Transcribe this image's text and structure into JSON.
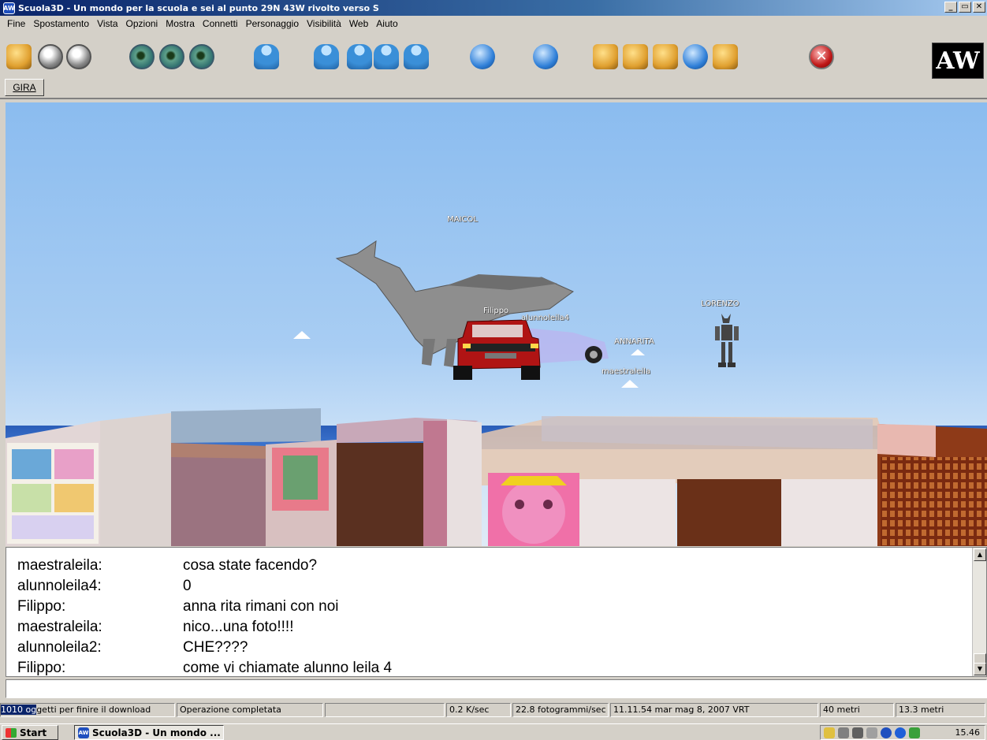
{
  "window": {
    "title": "Scuola3D - Un mondo per la scuola e sei al punto 29N 43W rivolto verso S",
    "app_icon": "AW",
    "controls": [
      "_",
      "▭",
      "✕"
    ]
  },
  "menu": [
    "Fine",
    "Spostamento",
    "Vista",
    "Opzioni",
    "Mostra",
    "Connetti",
    "Personaggio",
    "Visibilità",
    "Web",
    "Aiuto"
  ],
  "toolbar": {
    "icons": [
      "home-icon",
      "back-nav-icon",
      "forward-nav-icon",
      "view-eye-icon",
      "view-eye-icon",
      "view-eye-icon",
      "avatar-icon",
      "person-icon",
      "person-eye-icon",
      "person-icon",
      "people-icon",
      "chat-icon",
      "browser-icon",
      "tool-icon",
      "edit-icon",
      "map-icon",
      "globe-icon",
      "help-icon",
      "stop-icon"
    ],
    "logo_text": "AW",
    "gira_label": "GIRA"
  },
  "viewport": {
    "avatars": [
      "MAICOL",
      "Filippo",
      "alunnoleila4",
      "LORENZO",
      "ANNARITA",
      "maestraleila"
    ]
  },
  "chat": {
    "messages": [
      {
        "user": "maestraleila:",
        "text": "cosa state facendo?"
      },
      {
        "user": "alunnoleila4:",
        "text": "0"
      },
      {
        "user": "Filippo:",
        "text": "anna rita rimani con noi"
      },
      {
        "user": "maestraleila:",
        "text": "nico...una foto!!!!"
      },
      {
        "user": "alunnoleila2:",
        "text": "CHE????"
      },
      {
        "user": "Filippo:",
        "text": "come vi chiamate alunno leila 4"
      }
    ],
    "input_value": ""
  },
  "status": {
    "download_count": "1010 og",
    "download_rest": "getti per finire il download",
    "operation": "Operazione completata",
    "empty": "",
    "speed": "0.2 K/sec",
    "fps": "22.8 fotogrammi/sec",
    "datetime": "11.11.54 mar mag 8, 2007 VRT",
    "distance1": "40 metri",
    "distance2": "13.3 metri"
  },
  "taskbar": {
    "start_label": "Start",
    "task_label": "Scuola3D - Un mondo ...",
    "clock": "15.46"
  }
}
